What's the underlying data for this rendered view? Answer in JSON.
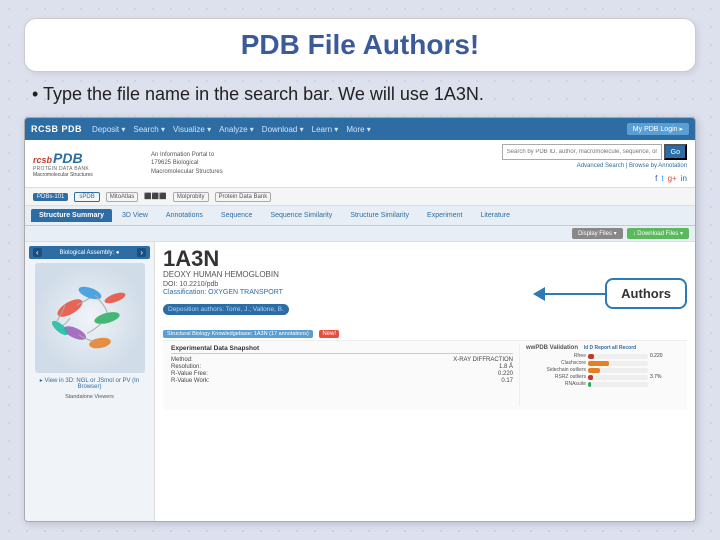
{
  "slide": {
    "title": "PDB File Authors!",
    "bullet": "• Type the file name in the search bar.  We will use 1A3N."
  },
  "nav": {
    "logo": "RCSB PDB",
    "links": [
      "Deposit ▾",
      "Search ▾",
      "Visualize ▾",
      "Analyze ▾",
      "Download ▾",
      "Learn ▾",
      "More ▾"
    ],
    "login_btn": "My PDB Login ▸"
  },
  "pdb_header": {
    "logo": "rcsb PDB",
    "logo_sub": "PROTEIN DATA BANK",
    "logo_sub2": "Macromolecular Structures",
    "desc_line1": "An Information Portal to",
    "desc_line2": "179625 Biological",
    "desc_line3": "Macromolecular Structures",
    "search_placeholder": "Search by PDB ID, author, macromolecule, sequence, or ligands",
    "go_label": "Go",
    "adv_search": "Advanced Search | Browse by Annotation"
  },
  "partners": [
    "Pdbs-101",
    "SPDB",
    "MitoAtlas",
    "⬛ ⬛ ⬛",
    "Molprobity",
    "Protein Data Bank"
  ],
  "tabs": [
    "Structure Summary",
    "3D View",
    "Annotations",
    "Sequence",
    "Sequence Similarity",
    "Structure Similarity",
    "Experiment",
    "Literature"
  ],
  "entry": {
    "id": "1A3N",
    "name": "DEOXY HUMAN HEMOGLOBIN",
    "doi": "DOI: 10.2210/pdb",
    "classification_label": "Classification:",
    "classification_value": "OXYGEN TRANSPORT",
    "deposition_label": "Deposition authors:",
    "deposition_authors": "Torre, J.; Vallone, B."
  },
  "bio_assembly": "Biological Assembly: ●",
  "authors_bubble": "Authors",
  "download_btns": {
    "display": "Display Files ▾",
    "download": "↓ Download Files ▾"
  },
  "struct_bio": "Structural Biology Knowledgebase: 1A3N (17 annotations)",
  "exp_data": {
    "header": "Experimental Data Snapshot",
    "rows": [
      [
        "Method:",
        "X-RAY DIFFRACTION"
      ],
      [
        "Resolution:",
        "1.8 Å"
      ],
      [
        "R-Value Free:",
        "0.220"
      ],
      [
        "R-Value Work:",
        "0.17"
      ]
    ]
  },
  "wwpdb_header": "wwPDB Validation",
  "val_header2": "ld D Report  all Record",
  "val_bars": [
    {
      "label": "Rfree",
      "pct": 10,
      "color": "red",
      "val": "0.220"
    },
    {
      "label": "Clashscore",
      "pct": 35,
      "color": "orange",
      "val": ""
    },
    {
      "label": "Sidechain outliers",
      "pct": 20,
      "color": "orange",
      "val": ""
    },
    {
      "label": "RSRZ outliers",
      "pct": 8,
      "color": "red",
      "val": "3.7%"
    },
    {
      "label": "RNAsuite",
      "pct": 5,
      "color": "green",
      "val": ""
    }
  ],
  "view_link": "▸ View in 3D: NGL or JSmol or PV (In Browser)",
  "standalone": "Standalone Viewers"
}
